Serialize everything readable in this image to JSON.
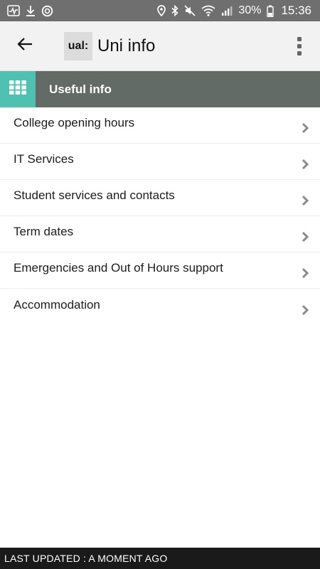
{
  "status_bar": {
    "left_icons": [
      "activity-icon",
      "download-icon",
      "sync-icon"
    ],
    "right_icons": [
      "location-icon",
      "bluetooth-icon",
      "mute-icon",
      "wifi-icon",
      "signal-icon",
      "battery-icon"
    ],
    "battery": "30%",
    "time": "15:36"
  },
  "app_bar": {
    "logo_text": "ual:",
    "title": "Uni info"
  },
  "section": {
    "title": "Useful info"
  },
  "list": [
    {
      "label": "College opening hours"
    },
    {
      "label": "IT Services"
    },
    {
      "label": "Student services and contacts"
    },
    {
      "label": "Term dates"
    },
    {
      "label": "Emergencies and Out of Hours support"
    },
    {
      "label": "Accommodation"
    }
  ],
  "footer": {
    "text": "LAST UPDATED : A MOMENT AGO"
  },
  "colors": {
    "status_bar": "#6f6f6f",
    "app_bar": "#f2f2f2",
    "section_header": "#636b66",
    "accent": "#4ec1b0",
    "footer": "#1a1a1a"
  }
}
